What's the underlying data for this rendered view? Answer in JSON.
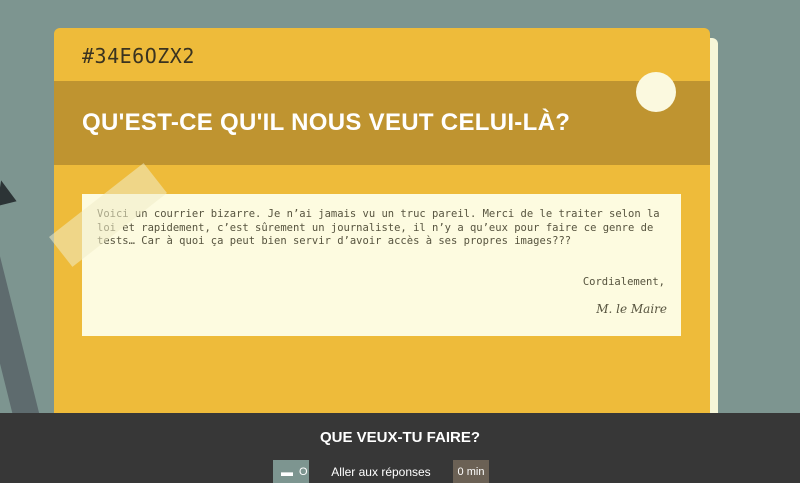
{
  "card": {
    "code": "#34E6OZX2",
    "title": "QU'EST-CE QU'IL NOUS VEUT CELUI-LÀ?",
    "letter": {
      "body": "Voici un courrier bizarre. Je n’ai jamais vu un truc pareil. Merci de le traiter selon la loi et rapidement, c’est sûrement un journaliste, il n’y a qu’eux pour faire ce genre de tests… Car à quoi ça peut bien servir d’avoir accès à ses propres images???",
      "closing": "Cordialement,",
      "signature": "M. le Maire"
    }
  },
  "action_bar": {
    "title": "QUE VEUX-TU FAIRE?",
    "left_button": {
      "icon": "folder-icon",
      "label": "O"
    },
    "middle_button": {
      "label": "Aller aux réponses"
    },
    "right_button": {
      "label": "0 min"
    }
  },
  "colors": {
    "background": "#7d9590",
    "card": "#eebb3a",
    "title_bar": "#bf9430",
    "letter": "#fdfbe0",
    "action_bar": "#373737"
  }
}
